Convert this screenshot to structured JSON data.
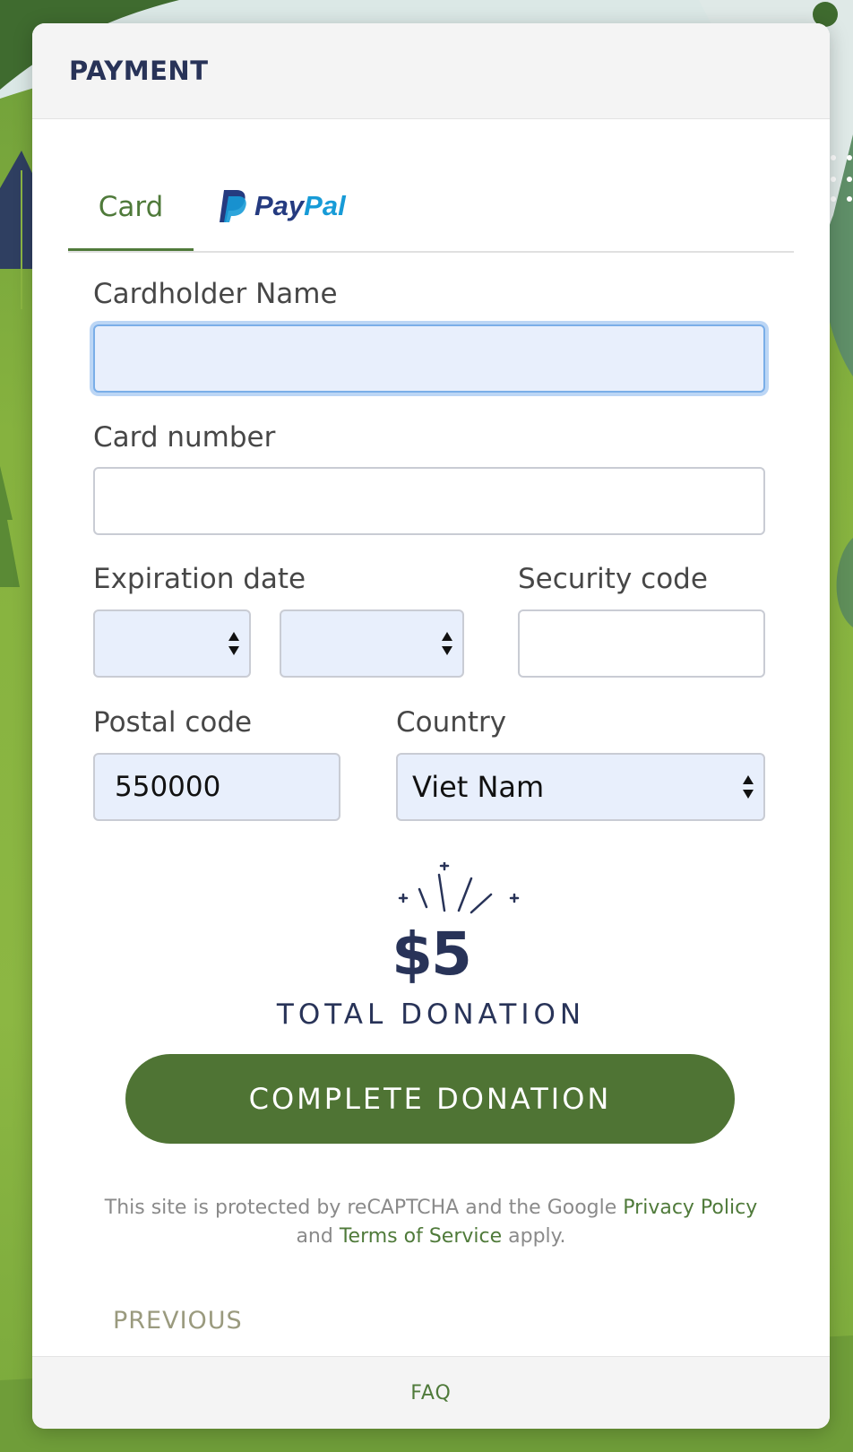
{
  "header": {
    "title": "PAYMENT"
  },
  "tabs": {
    "card_label": "Card",
    "paypal_word_1": "Pay",
    "paypal_word_2": "Pal"
  },
  "form": {
    "cardholder_label": "Cardholder Name",
    "cardholder_value": "",
    "card_number_label": "Card number",
    "card_number_value": "",
    "expiration_label": "Expiration date",
    "exp_month_value": "",
    "exp_year_value": "",
    "security_label": "Security code",
    "security_value": "",
    "postal_label": "Postal code",
    "postal_value": "550000",
    "country_label": "Country",
    "country_value": "Viet Nam"
  },
  "donation": {
    "amount": "$5",
    "total_label": "TOTAL DONATION",
    "button_label": "COMPLETE DONATION"
  },
  "recaptcha": {
    "text_before": "This site is protected by reCAPTCHA and the Google ",
    "privacy_link": "Privacy Policy",
    "text_middle": " and ",
    "terms_link": "Terms of Service",
    "text_after": " apply."
  },
  "nav": {
    "previous_label": "PREVIOUS"
  },
  "footer": {
    "faq_label": "FAQ"
  },
  "colors": {
    "accent_green": "#4f7434",
    "navy": "#283358",
    "input_fill": "#e8effc",
    "paypal_dark": "#253b80",
    "paypal_light": "#179bd7"
  }
}
